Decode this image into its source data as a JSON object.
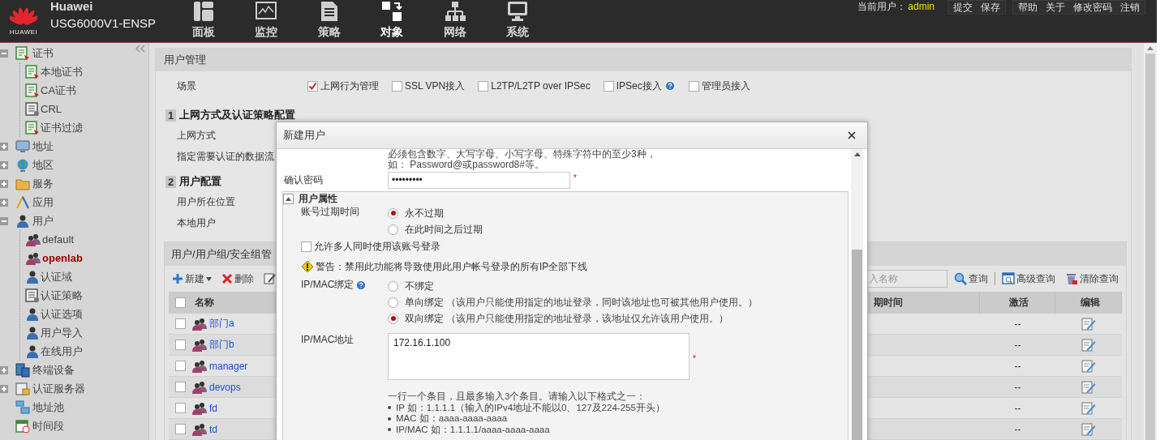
{
  "header": {
    "logo_text": "HUAWEI",
    "brand": "Huawei",
    "product": "USG6000V1-ENSP",
    "nav": [
      {
        "label": "面板",
        "kind": "dashboard",
        "selected": false
      },
      {
        "label": "监控",
        "kind": "monitor",
        "selected": false
      },
      {
        "label": "策略",
        "kind": "document",
        "selected": false
      },
      {
        "label": "对象",
        "kind": "object",
        "selected": true
      },
      {
        "label": "网络",
        "kind": "network",
        "selected": false
      },
      {
        "label": "系统",
        "kind": "screen",
        "selected": false
      }
    ],
    "current_user_label": "当前用户：",
    "current_user": "admin",
    "link_groups": [
      [
        "提交",
        "保存"
      ],
      [
        "帮助",
        "关于",
        "修改密码",
        "注销"
      ]
    ]
  },
  "sidebar": {
    "items": [
      {
        "label": "证书",
        "kind": "cert",
        "expanded": true,
        "selected": false,
        "children": [
          {
            "label": "本地证书",
            "kind": "cert",
            "selected": false
          },
          {
            "label": "CA证书",
            "kind": "cert",
            "selected": false
          },
          {
            "label": "CRL",
            "kind": "list",
            "selected": false
          },
          {
            "label": "证书过滤",
            "kind": "cert",
            "selected": false
          }
        ]
      },
      {
        "label": "地址",
        "kind": "monitor",
        "expanded": false,
        "selected": false
      },
      {
        "label": "地区",
        "kind": "globe",
        "expanded": false,
        "selected": false
      },
      {
        "label": "服务",
        "kind": "folder",
        "expanded": false,
        "selected": false
      },
      {
        "label": "应用",
        "kind": "tool",
        "expanded": false,
        "selected": false
      },
      {
        "label": "用户",
        "kind": "user",
        "expanded": true,
        "selected": false,
        "children": [
          {
            "label": "default",
            "kind": "users",
            "selected": false
          },
          {
            "label": "openlab",
            "kind": "users",
            "selected": true
          },
          {
            "label": "认证域",
            "kind": "user",
            "selected": false
          },
          {
            "label": "认证策略",
            "kind": "list",
            "selected": false
          },
          {
            "label": "认证选项",
            "kind": "user",
            "selected": false
          },
          {
            "label": "用户导入",
            "kind": "user",
            "selected": false
          },
          {
            "label": "在线用户",
            "kind": "user",
            "selected": false
          }
        ]
      },
      {
        "label": "终端设备",
        "kind": "device",
        "expanded": false,
        "selected": false
      },
      {
        "label": "认证服务器",
        "kind": "server",
        "expanded": false,
        "selected": false
      },
      {
        "label": "地址池",
        "kind": "pool",
        "selected": false
      },
      {
        "label": "时间段",
        "kind": "clock",
        "selected": false
      }
    ]
  },
  "user_management": {
    "title": "用户管理",
    "scenario_label": "场景",
    "scenarios": [
      {
        "label": "上网行为管理",
        "checked": true
      },
      {
        "label": "SSL VPN接入",
        "checked": false
      },
      {
        "label": "L2TP/L2TP over IPSec",
        "checked": false
      },
      {
        "label": "IPSec接入",
        "checked": false,
        "help": true
      },
      {
        "label": "管理员接入",
        "checked": false
      }
    ],
    "sections": [
      {
        "number": "1",
        "title": "上网方式及认证策略配置",
        "rows": [
          "上网方式",
          "指定需要认证的数据流"
        ]
      },
      {
        "number": "2",
        "title": "用户配置",
        "rows": [
          "用户所在位置",
          "本地用户"
        ]
      }
    ]
  },
  "user_list": {
    "title": "用户/用户组/安全组管",
    "new_label": "新建",
    "delete_label": "删除",
    "search_placeholder": "入名称",
    "search_label": "查询",
    "advanced_label": "高级查询",
    "clear_label": "清除查询",
    "select_all_checked": false,
    "columns": [
      "名称",
      "期时间",
      "激活",
      "编辑"
    ],
    "rows": [
      {
        "name": "部门a",
        "active": "--",
        "checked": false
      },
      {
        "name": "部门b",
        "active": "--",
        "checked": false
      },
      {
        "name": "manager",
        "active": "--",
        "checked": false
      },
      {
        "name": "devops",
        "active": "--",
        "checked": false
      },
      {
        "name": "fd",
        "active": "--",
        "checked": false
      },
      {
        "name": "td",
        "active": "--",
        "checked": false
      }
    ]
  },
  "dialog": {
    "title": "新建用户",
    "hint_lines": [
      "必须包含数字、大写字母、小写字母、特殊字符中的至少3种，",
      "如： Password@或password8#等。"
    ],
    "confirm_password": {
      "label": "确认密码",
      "value": "•••••••••",
      "required_mark": "*"
    },
    "properties": {
      "title": "用户属性",
      "expanded": true,
      "expiry_label": "账号过期时间",
      "expiry_options": [
        {
          "label": "永不过期",
          "selected": true
        },
        {
          "label": "在此时间之后过期",
          "selected": false
        }
      ],
      "multi_login": {
        "label": "允许多人同时使用该账号登录",
        "checked": false
      },
      "warning": "警告：禁用此功能将导致使用此用户帐号登录的所有IP全部下线",
      "binding_label": "IP/MAC绑定",
      "binding_options": [
        {
          "label": "不绑定",
          "selected": false
        },
        {
          "label": "单向绑定",
          "note": "（该用户只能使用指定的地址登录，同时该地址也可被其他用户使用。）",
          "selected": false
        },
        {
          "label": "双向绑定",
          "note": "（该用户只能使用指定的地址登录，该地址仅允许该用户使用。）",
          "selected": true
        }
      ],
      "address_label": "IP/MAC地址",
      "address_value": "172.16.1.100",
      "address_required_mark": "*",
      "format_intro": "一行一个条目，且最多输入3个条目。请输入以下格式之一：",
      "formats": [
        "IP 如：1.1.1.1（输入的IPv4地址不能以0、127及224-255开头）",
        "MAC 如：aaaa-aaaa-aaaa",
        "IP/MAC 如：1.1.1.1/aaaa-aaaa-aaaa"
      ]
    }
  }
}
